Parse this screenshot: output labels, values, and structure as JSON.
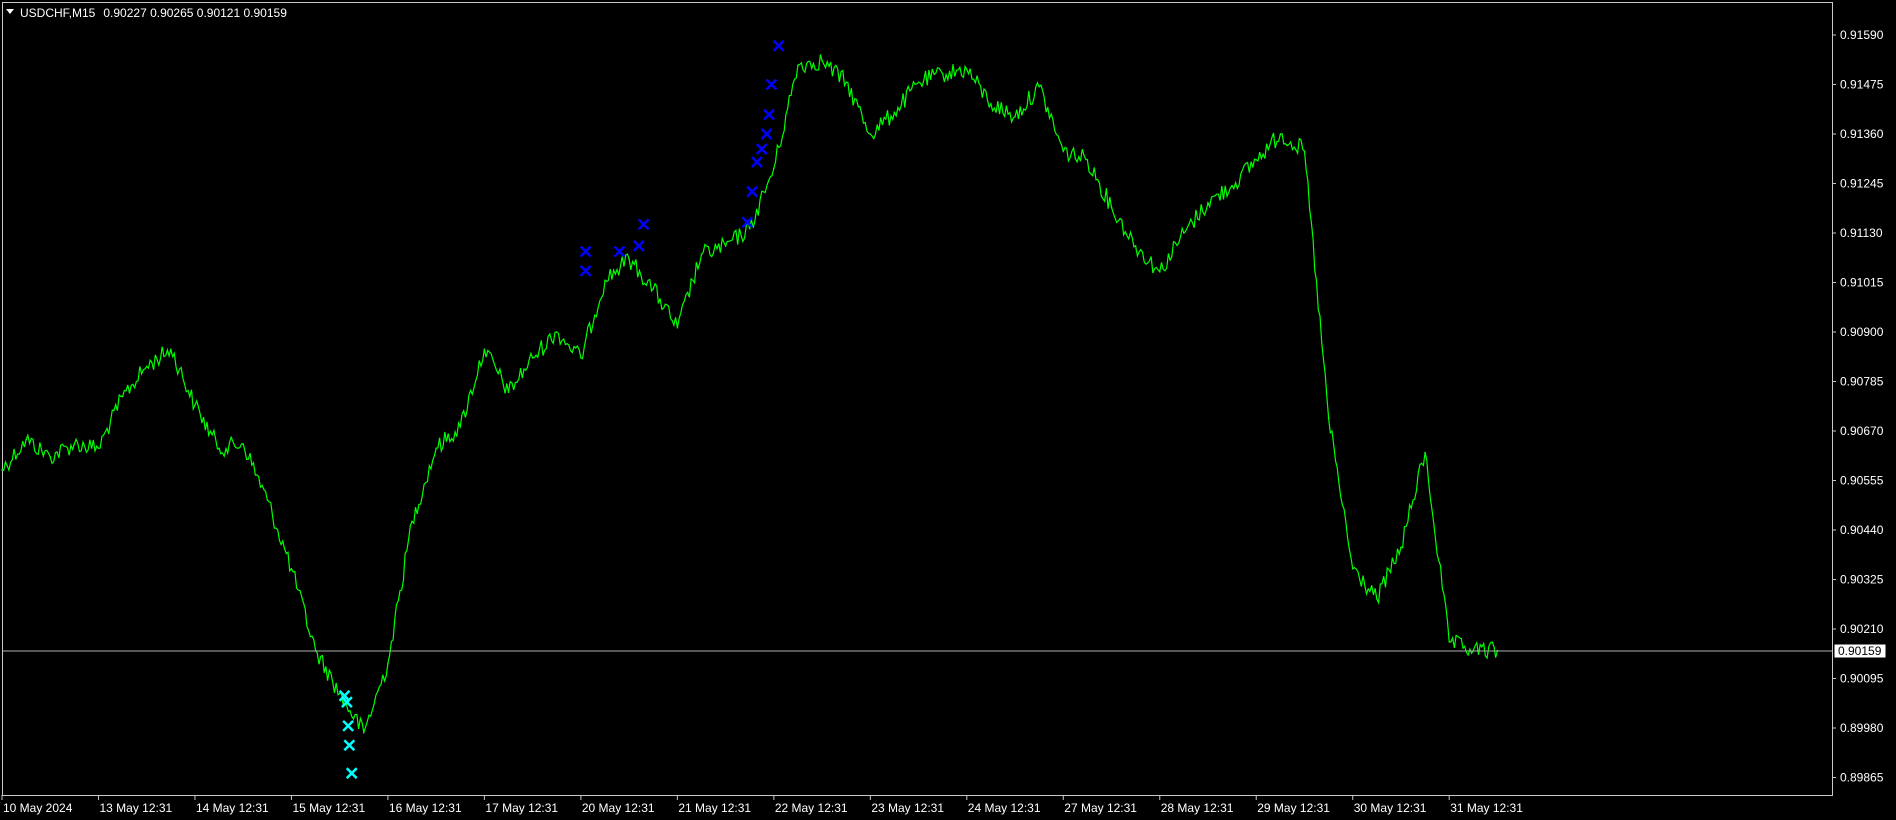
{
  "header": {
    "symbol": "USDCHF,M15",
    "ohlc": "0.90227 0.90265 0.90121 0.90159"
  },
  "colors": {
    "background": "#000000",
    "price_line": "#00ff00",
    "axis": "#c8c8c8",
    "text": "#ffffff",
    "bid_line": "#b0b0b0",
    "marker_sell": "#0000ff",
    "marker_buy": "#00ffff"
  },
  "chart_data": {
    "type": "line",
    "grid": false,
    "y_tick_labels": [
      "0.91590",
      "0.91475",
      "0.91360",
      "0.91245",
      "0.91130",
      "0.91015",
      "0.90900",
      "0.90785",
      "0.90670",
      "0.90555",
      "0.90440",
      "0.90325",
      "0.90210",
      "0.90095",
      "0.89980",
      "0.89865"
    ],
    "ylim": [
      0.8984,
      0.9163
    ],
    "current_price": "0.90159",
    "x_tick_labels": [
      "10 May 2024",
      "13 May 12:31",
      "14 May 12:31",
      "15 May 12:31",
      "16 May 12:31",
      "17 May 12:31",
      "20 May 12:31",
      "21 May 12:31",
      "22 May 12:31",
      "23 May 12:31",
      "24 May 12:31",
      "27 May 12:31",
      "28 May 12:31",
      "29 May 12:31",
      "30 May 12:31",
      "31 May 12:31"
    ],
    "x_tick_index": [
      0,
      4,
      8,
      12,
      16,
      20,
      24,
      28,
      32,
      36,
      40,
      44,
      48,
      52,
      56,
      60
    ],
    "series": [
      {
        "index": [
          0,
          1,
          2,
          3,
          4,
          5,
          6,
          7,
          8,
          9,
          10,
          11,
          12,
          13,
          14,
          15,
          16,
          17,
          18,
          19,
          20,
          21,
          22,
          23,
          24,
          25,
          26,
          27,
          28,
          29,
          30,
          31,
          32,
          33,
          34,
          35,
          36,
          37,
          38,
          39,
          40,
          41,
          42,
          43,
          44,
          45,
          46,
          47,
          48,
          49,
          50,
          51,
          52,
          53,
          54,
          55,
          56,
          57,
          58,
          59,
          60,
          61,
          62
        ],
        "values": [
          0.9058,
          0.9065,
          0.9061,
          0.9064,
          0.9063,
          0.9075,
          0.9082,
          0.9086,
          0.9073,
          0.9063,
          0.9064,
          0.9051,
          0.9035,
          0.9016,
          0.9006,
          0.8997,
          0.9013,
          0.9046,
          0.9063,
          0.9068,
          0.9086,
          0.9076,
          0.9084,
          0.909,
          0.9084,
          0.9102,
          0.9107,
          0.91,
          0.9091,
          0.9108,
          0.911,
          0.9114,
          0.9128,
          0.9152,
          0.9153,
          0.9148,
          0.9136,
          0.9141,
          0.9148,
          0.915,
          0.9151,
          0.9143,
          0.914,
          0.9147,
          0.9132,
          0.913,
          0.9119,
          0.911,
          0.9104,
          0.9113,
          0.912,
          0.9124,
          0.913,
          0.9136,
          0.9132,
          0.907,
          0.9035,
          0.9028,
          0.904,
          0.9062,
          0.9018,
          0.9016,
          0.9016
        ]
      }
    ],
    "sell_markers": [
      {
        "x": 24.2,
        "y": 0.91087
      },
      {
        "x": 24.2,
        "y": 0.91042
      },
      {
        "x": 25.6,
        "y": 0.91087
      },
      {
        "x": 26.4,
        "y": 0.911
      },
      {
        "x": 26.6,
        "y": 0.9115
      },
      {
        "x": 30.9,
        "y": 0.91155
      },
      {
        "x": 31.1,
        "y": 0.91226
      },
      {
        "x": 31.3,
        "y": 0.91295
      },
      {
        "x": 31.5,
        "y": 0.91325
      },
      {
        "x": 31.7,
        "y": 0.9136
      },
      {
        "x": 31.8,
        "y": 0.91405
      },
      {
        "x": 31.9,
        "y": 0.91475
      },
      {
        "x": 32.2,
        "y": 0.91565
      }
    ],
    "buy_markers": [
      {
        "x": 14.2,
        "y": 0.90055
      },
      {
        "x": 14.3,
        "y": 0.9004
      },
      {
        "x": 14.35,
        "y": 0.89985
      },
      {
        "x": 14.4,
        "y": 0.8994
      },
      {
        "x": 14.5,
        "y": 0.89875
      }
    ]
  }
}
